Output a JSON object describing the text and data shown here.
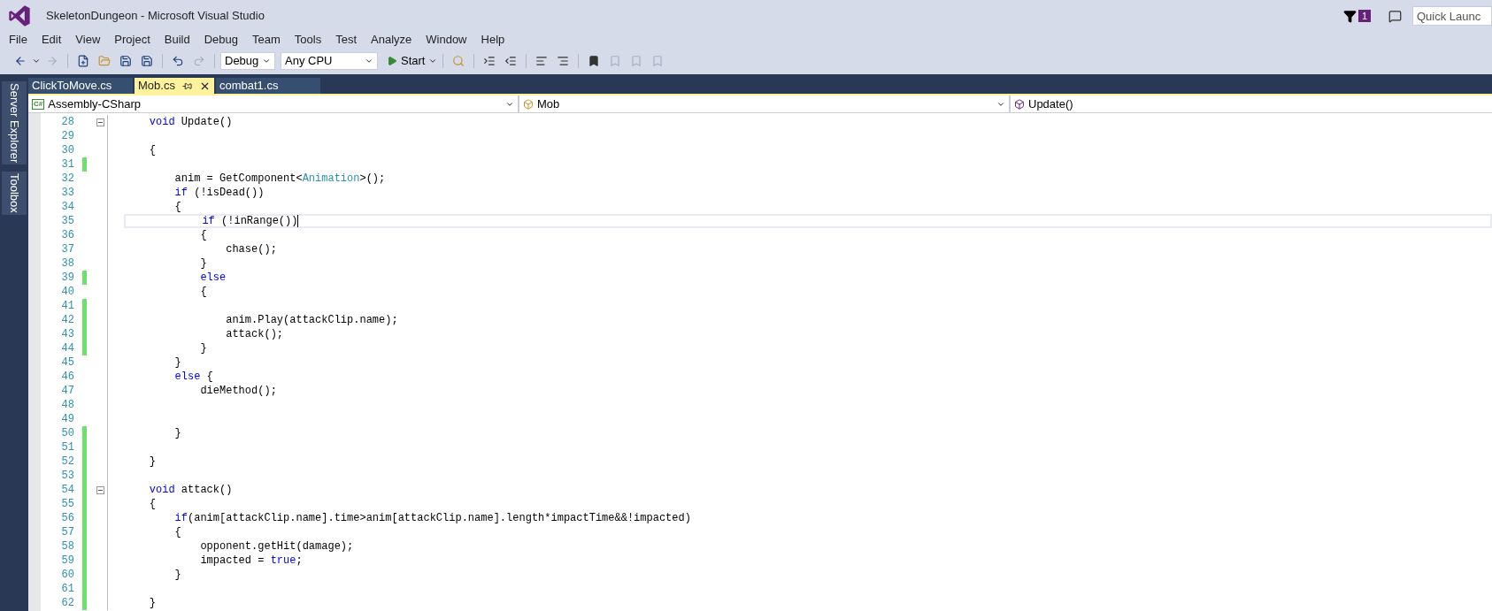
{
  "window": {
    "title": "SkeletonDungeon - Microsoft Visual Studio",
    "notification_count": "1",
    "quick_launch": {
      "placeholder": "Quick Launc"
    }
  },
  "menu": [
    "File",
    "Edit",
    "View",
    "Project",
    "Build",
    "Debug",
    "Team",
    "Tools",
    "Test",
    "Analyze",
    "Window",
    "Help"
  ],
  "toolbar": {
    "configuration": "Debug",
    "platform": "Any CPU",
    "start": "Start"
  },
  "side_tabs": [
    "Server Explorer",
    "Toolbox"
  ],
  "tabs": [
    {
      "label": "ClickToMove.cs",
      "selected": false
    },
    {
      "label": "Mob.cs",
      "selected": true
    },
    {
      "label": "combat1.cs",
      "selected": false
    }
  ],
  "nav": {
    "project_badge": "C#",
    "project": "Assembly-CSharp",
    "type": "Mob",
    "member": "Update()"
  },
  "lines": [
    {
      "number": "28",
      "changed": false,
      "collapse_box": true,
      "current": false,
      "tokens": [
        {
          "t": "    void",
          "kind": "keyword"
        },
        {
          "t": " Update()"
        }
      ]
    },
    {
      "number": "29",
      "changed": false,
      "collapse_box": false,
      "current": false
    },
    {
      "number": "30",
      "changed": false,
      "collapse_box": false,
      "current": false,
      "tokens": [
        {
          "t": "    {"
        }
      ]
    },
    {
      "number": "31",
      "changed": true,
      "collapse_box": false,
      "current": false
    },
    {
      "number": "32",
      "changed": false,
      "collapse_box": false,
      "current": false,
      "tokens": [
        {
          "t": "        anim = GetComponent<"
        },
        {
          "t": "Animation",
          "kind": "type"
        },
        {
          "t": ">();"
        }
      ]
    },
    {
      "number": "33",
      "changed": false,
      "collapse_box": false,
      "current": false,
      "tokens": [
        {
          "t": "        if",
          "kind": "keyword"
        },
        {
          "t": " (!isDead())"
        }
      ]
    },
    {
      "number": "34",
      "changed": false,
      "collapse_box": false,
      "current": false,
      "tokens": [
        {
          "t": "        {"
        }
      ]
    },
    {
      "number": "35",
      "changed": false,
      "collapse_box": false,
      "current": true,
      "tokens": [
        {
          "t": "            if",
          "kind": "keyword"
        },
        {
          "t": " (!inRange())"
        }
      ]
    },
    {
      "number": "36",
      "changed": false,
      "collapse_box": false,
      "current": false,
      "tokens": [
        {
          "t": "            {"
        }
      ]
    },
    {
      "number": "37",
      "changed": false,
      "collapse_box": false,
      "current": false,
      "tokens": [
        {
          "t": "                chase();"
        }
      ]
    },
    {
      "number": "38",
      "changed": false,
      "collapse_box": false,
      "current": false,
      "tokens": [
        {
          "t": "            }"
        }
      ]
    },
    {
      "number": "39",
      "changed": true,
      "collapse_box": false,
      "current": false,
      "tokens": [
        {
          "t": "            else",
          "kind": "keyword"
        }
      ]
    },
    {
      "number": "40",
      "changed": false,
      "collapse_box": false,
      "current": false,
      "tokens": [
        {
          "t": "            {"
        }
      ]
    },
    {
      "number": "41",
      "changed": true,
      "collapse_box": false,
      "current": false
    },
    {
      "number": "42",
      "changed": true,
      "collapse_box": false,
      "current": false,
      "tokens": [
        {
          "t": "                anim.Play(attackClip.name);"
        }
      ]
    },
    {
      "number": "43",
      "changed": true,
      "collapse_box": false,
      "current": false,
      "tokens": [
        {
          "t": "                attack();"
        }
      ]
    },
    {
      "number": "44",
      "changed": true,
      "collapse_box": false,
      "current": false,
      "tokens": [
        {
          "t": "            }"
        }
      ]
    },
    {
      "number": "45",
      "changed": false,
      "collapse_box": false,
      "current": false,
      "tokens": [
        {
          "t": "        }"
        }
      ]
    },
    {
      "number": "46",
      "changed": false,
      "collapse_box": false,
      "current": false,
      "tokens": [
        {
          "t": "        else",
          "kind": "keyword"
        },
        {
          "t": " {"
        }
      ]
    },
    {
      "number": "47",
      "changed": false,
      "collapse_box": false,
      "current": false,
      "tokens": [
        {
          "t": "            dieMethod();"
        }
      ]
    },
    {
      "number": "48",
      "changed": false,
      "collapse_box": false,
      "current": false
    },
    {
      "number": "49",
      "changed": false,
      "collapse_box": false,
      "current": false
    },
    {
      "number": "50",
      "changed": true,
      "collapse_box": false,
      "current": false,
      "tokens": [
        {
          "t": "        }"
        }
      ]
    },
    {
      "number": "51",
      "changed": true,
      "collapse_box": false,
      "current": false
    },
    {
      "number": "52",
      "changed": true,
      "collapse_box": false,
      "current": false,
      "tokens": [
        {
          "t": "    }"
        }
      ]
    },
    {
      "number": "53",
      "changed": true,
      "collapse_box": false,
      "current": false
    },
    {
      "number": "54",
      "changed": true,
      "collapse_box": true,
      "current": false,
      "tokens": [
        {
          "t": "    void",
          "kind": "keyword"
        },
        {
          "t": " attack()"
        }
      ]
    },
    {
      "number": "55",
      "changed": true,
      "collapse_box": false,
      "current": false,
      "tokens": [
        {
          "t": "    {"
        }
      ]
    },
    {
      "number": "56",
      "changed": true,
      "collapse_box": false,
      "current": false,
      "tokens": [
        {
          "t": "        if",
          "kind": "keyword"
        },
        {
          "t": "(anim[attackClip.name].time>anim[attackClip.name].length*impactTime&&!impacted)"
        }
      ]
    },
    {
      "number": "57",
      "changed": true,
      "collapse_box": false,
      "current": false,
      "tokens": [
        {
          "t": "        {"
        }
      ]
    },
    {
      "number": "58",
      "changed": true,
      "collapse_box": false,
      "current": false,
      "tokens": [
        {
          "t": "            opponent.getHit(damage);"
        }
      ]
    },
    {
      "number": "59",
      "changed": true,
      "collapse_box": false,
      "current": false,
      "tokens": [
        {
          "t": "            impacted = "
        },
        {
          "t": "true",
          "kind": "keyword"
        },
        {
          "t": ";"
        }
      ]
    },
    {
      "number": "60",
      "changed": true,
      "collapse_box": false,
      "current": false,
      "tokens": [
        {
          "t": "        }"
        }
      ]
    },
    {
      "number": "61",
      "changed": true,
      "collapse_box": false,
      "current": false
    },
    {
      "number": "62",
      "changed": true,
      "collapse_box": false,
      "current": false,
      "tokens": [
        {
          "t": "    }"
        }
      ]
    }
  ]
}
